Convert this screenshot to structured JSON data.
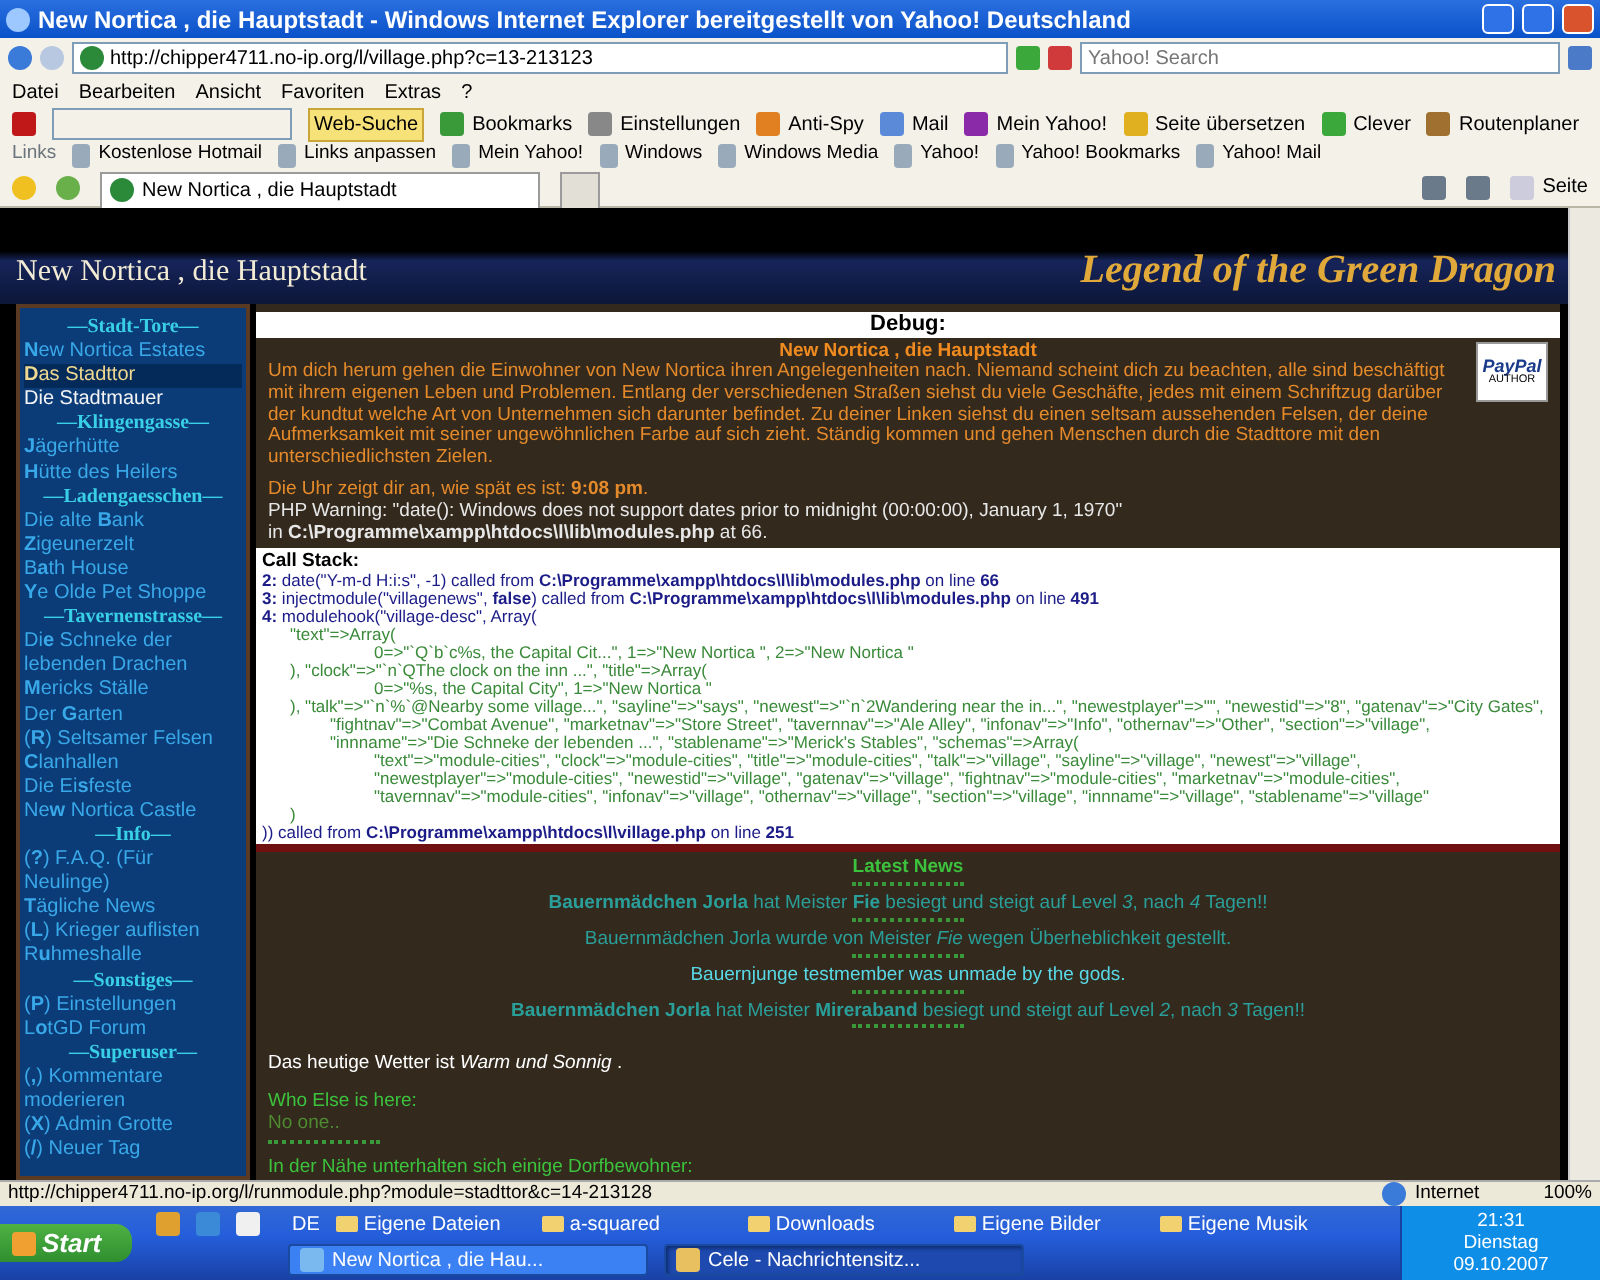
{
  "window": {
    "title": "New Nortica , die Hauptstadt - Windows Internet Explorer bereitgestellt von Yahoo! Deutschland"
  },
  "address_bar": {
    "url": "http://chipper4711.no-ip.org/l/village.php?c=13-213123",
    "search_placeholder": "Yahoo! Search"
  },
  "menu": [
    "Datei",
    "Bearbeiten",
    "Ansicht",
    "Favoriten",
    "Extras",
    "?"
  ],
  "yahoo_toolbar": {
    "search_button": "Web-Suche",
    "items": [
      "Bookmarks",
      "Einstellungen",
      "Anti-Spy",
      "Mail",
      "Mein Yahoo!",
      "Seite übersetzen",
      "Clever",
      "Routenplaner"
    ]
  },
  "links_bar": {
    "label": "Links",
    "items": [
      "Kostenlose Hotmail",
      "Links anpassen",
      "Mein Yahoo!",
      "Windows",
      "Windows Media",
      "Yahoo!",
      "Yahoo! Bookmarks",
      "Yahoo! Mail"
    ]
  },
  "tabs": [
    {
      "label": "New Nortica , die Hauptstadt",
      "selected": true
    }
  ],
  "command_bar": {
    "page_menu": "Seite"
  },
  "page": {
    "title": "New Nortica , die Hauptstadt",
    "logo": "Legend of the Green Dragon",
    "nav": [
      {
        "kind": "header",
        "label": "—Stadt-Tore—"
      },
      {
        "kind": "link",
        "label": "**N**ew Nortica Estates",
        "selected": false
      },
      {
        "kind": "link",
        "label": "**D**as Stadttor",
        "selected": true
      },
      {
        "kind": "text",
        "label": "Die Stadtmauer",
        "selected": false
      },
      {
        "kind": "header",
        "label": "—Klingengasse—"
      },
      {
        "kind": "link",
        "label": "**J**ägerhütte",
        "selected": false
      },
      {
        "kind": "link",
        "label": "**H**ütte des Heilers",
        "selected": false
      },
      {
        "kind": "header",
        "label": "—Ladengaesschen—"
      },
      {
        "kind": "link",
        "label": "Die alte **B**ank",
        "selected": false
      },
      {
        "kind": "link",
        "label": "**Z**igeunerzelt",
        "selected": false
      },
      {
        "kind": "link",
        "label": "B**a**th House",
        "selected": false
      },
      {
        "kind": "link",
        "label": "**Y**e Olde Pet Shoppe",
        "selected": false
      },
      {
        "kind": "header",
        "label": "—Tavernenstrasse—"
      },
      {
        "kind": "link",
        "label": "Di**e** Schneke der lebenden Drachen",
        "selected": false
      },
      {
        "kind": "link",
        "label": "**M**ericks Ställe",
        "selected": false
      },
      {
        "kind": "link",
        "label": "Der **G**arten",
        "selected": false
      },
      {
        "kind": "link",
        "label": "(**R**) Seltsamer Felsen",
        "selected": false
      },
      {
        "kind": "link",
        "label": "**C**lanhallen",
        "selected": false
      },
      {
        "kind": "link",
        "label": "Die Ei**s**feste",
        "selected": false
      },
      {
        "kind": "link",
        "label": "Ne**w** Nortica Castle",
        "selected": false
      },
      {
        "kind": "header",
        "label": "—Info—"
      },
      {
        "kind": "link",
        "label": "(**?**) F.A.Q. (Für Neulinge)",
        "selected": false
      },
      {
        "kind": "link",
        "label": "**T**ägliche News",
        "selected": false
      },
      {
        "kind": "link",
        "label": "(**L**) Krieger auflisten",
        "selected": false
      },
      {
        "kind": "link",
        "label": "R**u**hmeshalle",
        "selected": false
      },
      {
        "kind": "header",
        "label": "—Sonstiges—"
      },
      {
        "kind": "link",
        "label": "(**P**) Einstellungen",
        "selected": false
      },
      {
        "kind": "link",
        "label": "L**o**tGD Forum",
        "selected": false
      },
      {
        "kind": "header",
        "label": "—Superuser—"
      },
      {
        "kind": "link",
        "label": "(**,**) Kommentare moderieren",
        "selected": false
      },
      {
        "kind": "link",
        "label": "(**X**) Admin Grotte",
        "selected": false
      },
      {
        "kind": "link",
        "label": "(**/**) Neuer Tag",
        "selected": false
      }
    ],
    "debug": {
      "heading": "Debug:"
    },
    "location": {
      "title": "New Nortica , die Hauptstadt",
      "description": "Um dich herum gehen die Einwohner von New Nortica ihren Angelegenheiten nach. Niemand scheint dich zu beachten, alle sind beschäftigt mit ihrem eigenen Leben und Problemen. Entlang der verschiedenen Straßen siehst du viele Geschäfte, jedes mit einem Schriftzug darüber der kundtut welche Art von Unternehmen sich darunter befindet. Zu deiner Linken siehst du einen seltsam aussehenden Felsen, der deine Aufmerksamkeit mit seiner ungewöhnlichen Farbe auf sich zieht. Ständig kommen und gehen Menschen durch die Stadttore mit den unterschiedlichsten Zielen.",
      "clock": "Die Uhr zeigt dir an, wie spät es ist: **9:08 pm**.",
      "warning": "PHP Warning: \"date(): Windows does not support dates prior to midnight (00:00:00), January 1, 1970\"",
      "warning_location": "in **C:\\Programme\\xampp\\htdocs\\l\\lib\\modules.php** at 66."
    },
    "badge": {
      "brand": "PayPal",
      "caption": "AUTHOR"
    },
    "call_stack": {
      "heading": "Call Stack:",
      "lines": [
        {
          "kind": "frame",
          "text": "**2:** date(\"Y-m-d H:i:s\", -1) called from **C:\\Programme\\xampp\\htdocs\\l\\lib\\modules.php** on line **66**"
        },
        {
          "kind": "frame",
          "text": "**3:** injectmodule(\"villagenews\", **false**) called from **C:\\Programme\\xampp\\htdocs\\l\\lib\\modules.php** on line **491**"
        },
        {
          "kind": "frame",
          "text": "**4:** modulehook(\"village-desc\", Array("
        },
        {
          "kind": "entry",
          "text": "\"text\"=>Array("
        },
        {
          "kind": "element",
          "text": "0=>\"`Q`b`c%s, the Capital Cit...\", 1=>\"New Nortica \", 2=>\"New Nortica \""
        },
        {
          "kind": "entry",
          "text": "), \"clock\"=>\"`n`QThe clock on the inn ...\", \"title\"=>Array("
        },
        {
          "kind": "element",
          "text": "0=>\"%s, the Capital City\", 1=>\"New Nortica \""
        },
        {
          "kind": "entry",
          "text": "), \"talk\"=>\"`n`%`@Nearby some village...\", \"sayline\"=>\"says\", \"newest\"=>\"`n`2Wandering near the in...\", \"newestplayer\"=>\"\", \"newestid\"=>\"8\", \"gatenav\"=>\"City Gates\", \"fightnav\"=>\"Combat Avenue\", \"marketnav\"=>\"Store Street\", \"tavernnav\"=>\"Ale Alley\", \"infonav\"=>\"Info\", \"othernav\"=>\"Other\", \"section\"=>\"village\", \"innname\"=>\"Die Schneke der lebenden ...\", \"stablename\"=>\"Merick's Stables\", \"schemas\"=>Array("
        },
        {
          "kind": "element",
          "text": "\"text\"=>\"module-cities\", \"clock\"=>\"module-cities\", \"title\"=>\"module-cities\", \"talk\"=>\"village\", \"sayline\"=>\"village\", \"newest\"=>\"village\", \"newestplayer\"=>\"module-cities\", \"newestid\"=>\"village\", \"gatenav\"=>\"village\", \"fightnav\"=>\"module-cities\", \"marketnav\"=>\"module-cities\", \"tavernnav\"=>\"module-cities\", \"infonav\"=>\"village\", \"othernav\"=>\"village\", \"section\"=>\"village\", \"innname\"=>\"village\", \"stablename\"=>\"village\""
        },
        {
          "kind": "entry",
          "text": ")"
        },
        {
          "kind": "frame",
          "text": ")) called from **C:\\Programme\\xampp\\htdocs\\l\\village.php** on line **251**"
        }
      ]
    },
    "news": {
      "heading": "Latest News",
      "items": [
        {
          "kind": "event",
          "text": "**Bauernmädchen Jorla** hat Meister **Fie** besiegt und steigt auf Level *3*, nach *4* Tagen!!"
        },
        {
          "kind": "event",
          "text": "Bauernmädchen Jorla wurde von Meister *Fie* wegen Überheblichkeit gestellt."
        },
        {
          "kind": "notice",
          "text": "Bauernjunge testmember was unmade by the gods."
        },
        {
          "kind": "event",
          "text": "**Bauernmädchen Jorla** hat Meister **Mireraband** besiegt und steigt auf Level *2*, nach *3* Tagen!!"
        }
      ]
    },
    "weather": "Das heutige Wetter ist *Warm und Sonnig* .",
    "who_else": {
      "heading": "Who Else is here:",
      "text": "No one.."
    },
    "chat_heading": "In der Nähe unterhalten sich einige Dorfbewohner:"
  },
  "status_bar": {
    "url": "http://chipper4711.no-ip.org/l/runmodule.php?module=stadttor&c=14-213128",
    "zone": "Internet",
    "zoom": "100%"
  },
  "taskbar": {
    "start": "Start",
    "language": "DE",
    "folders": [
      "Eigene Dateien",
      "a-squared",
      "Downloads",
      "Eigene Bilder",
      "Eigene Musik"
    ],
    "windows": [
      {
        "label": "New Nortica , die Hau...",
        "selected": false
      },
      {
        "label": "Cele - Nachrichtensitz...",
        "selected": true
      }
    ],
    "clock": {
      "time": "21:31",
      "day": "Dienstag",
      "date": "09.10.2007"
    }
  }
}
